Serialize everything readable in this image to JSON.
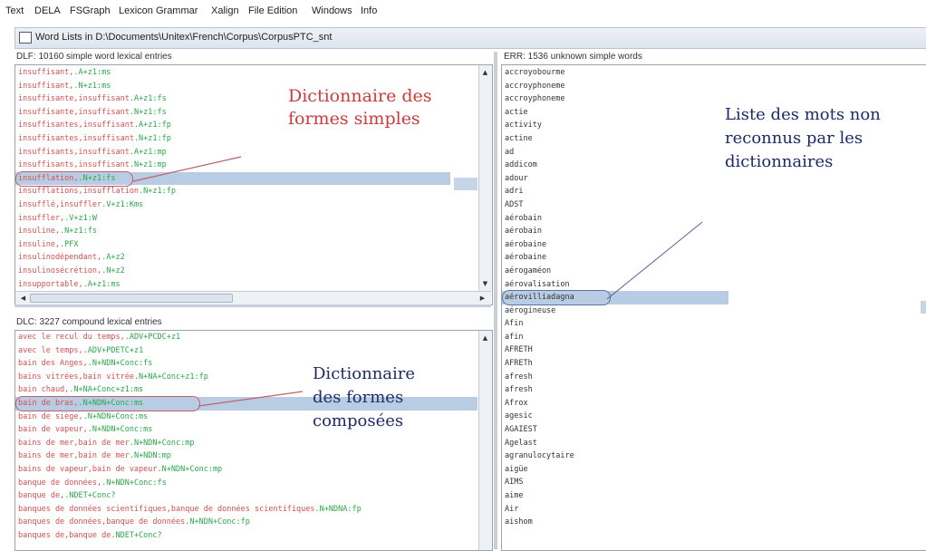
{
  "menubar": {
    "items": [
      "Text",
      "DELA",
      "FSGraph",
      "Lexicon Grammar",
      "Xalign",
      "File Edition",
      "Windows",
      "Info"
    ]
  },
  "window": {
    "title": "Word Lists in D:\\Documents\\Unitex\\French\\Corpus\\CorpusPTC_snt"
  },
  "dlf": {
    "header": "DLF: 10160 simple word lexical entries",
    "rows": [
      {
        "lemma": "insuffisant,",
        "code": ".A+z1:ms"
      },
      {
        "lemma": "insuffisant,",
        "code": ".N+z1:ms"
      },
      {
        "lemma": "insuffisante,insuffisant",
        "code": ".A+z1:fs"
      },
      {
        "lemma": "insuffisante,insuffisant",
        "code": ".N+z1:fs"
      },
      {
        "lemma": "insuffisantes,insuffisant",
        "code": ".A+z1:fp"
      },
      {
        "lemma": "insuffisantes,insuffisant",
        "code": ".N+z1:fp"
      },
      {
        "lemma": "insuffisants,insuffisant",
        "code": ".A+z1:mp"
      },
      {
        "lemma": "insuffisants,insuffisant",
        "code": ".N+z1:mp"
      },
      {
        "lemma": "insufflation,",
        "code": ".N+z1:fs"
      },
      {
        "lemma": "insufflations,insufflation",
        "code": ".N+z1:fp"
      },
      {
        "lemma": "insufflé,insuffler",
        "code": ".V+z1:Kms"
      },
      {
        "lemma": "insuffler,",
        "code": ".V+z1:W"
      },
      {
        "lemma": "insuline,",
        "code": ".N+z1:fs"
      },
      {
        "lemma": "insuline,",
        "code": ".PFX"
      },
      {
        "lemma": "insulinodépendant,",
        "code": ".A+z2"
      },
      {
        "lemma": "insulinosécrétion,",
        "code": ".N+z2"
      },
      {
        "lemma": "insupportable,",
        "code": ".A+z1:ms"
      }
    ]
  },
  "dlc": {
    "header": "DLC: 3227 compound lexical entries",
    "rows": [
      {
        "lemma": "avec le recul du temps,",
        "code": ".ADV+PCDC+z1"
      },
      {
        "lemma": "avec le temps,",
        "code": ".ADV+PDETC+z1"
      },
      {
        "lemma": "bain des Anges,",
        "code": ".N+NDN+Conc:fs"
      },
      {
        "lemma": "bains vitrées,bain vitrée",
        "code": ".N+NA+Conc+z1:fp"
      },
      {
        "lemma": "bain chaud,",
        "code": ".N+NA+Conc+z1:ms"
      },
      {
        "lemma": "bain de bras,",
        "code": ".N+NDN+Conc:ms"
      },
      {
        "lemma": "bain de siège,",
        "code": ".N+NDN+Conc:ms"
      },
      {
        "lemma": "bain de vapeur,",
        "code": ".N+NDN+Conc:ms"
      },
      {
        "lemma": "bains de mer,bain de mer",
        "code": ".N+NDN+Conc:mp"
      },
      {
        "lemma": "bains de mer,bain de mer",
        "code": ".N+NDN:mp"
      },
      {
        "lemma": "bains de vapeur,bain de vapeur",
        "code": ".N+NDN+Conc:mp"
      },
      {
        "lemma": "banque de données,",
        "code": ".N+NDN+Conc:fs"
      },
      {
        "lemma": "banque de,",
        "code": ".NDET+Conc?"
      },
      {
        "lemma": "banques de données scientifiques,banque de données scientifiques",
        "code": ".N+NDNA:fp"
      },
      {
        "lemma": "banques de données,banque de données",
        "code": ".N+NDN+Conc:fp"
      },
      {
        "lemma": "banques de,banque de",
        "code": ".NDET+Conc?"
      }
    ]
  },
  "err": {
    "header": "ERR: 1536 unknown simple words",
    "rows": [
      "accroyobourme",
      "accroyphoneme",
      "accroyphoneme",
      "actie",
      "activity",
      "actine",
      "ad",
      "addicom",
      "adour",
      "adri",
      "ADST",
      "aérobain",
      "aérobain",
      "aérobaine",
      "aérobaine",
      "aérogaméon",
      "aérovalisation",
      "aérovilliadagna",
      "aérogineuse",
      "Afin",
      "afin",
      "AFRETH",
      "AFRETh",
      "afresh",
      "afresh",
      "Afrox",
      "agesic",
      "AGAIEST",
      "Agelast",
      "agranulocytaire",
      "aigüe",
      "AIMS",
      "aime",
      "Air",
      "aishom"
    ]
  },
  "annotations": {
    "dlf": "Dictionnaire des formes simples",
    "dlc": "Dictionnaire des formes composées",
    "err": "Liste des mots non reconnus par les dictionnaires"
  }
}
